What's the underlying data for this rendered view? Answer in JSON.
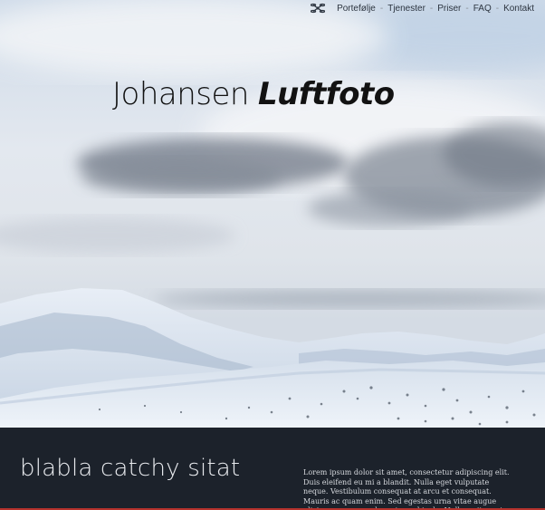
{
  "nav": {
    "logo_icon": "drone-icon",
    "items": [
      "Portefølje",
      "Tjenester",
      "Priser",
      "FAQ",
      "Kontakt"
    ],
    "separator": "-"
  },
  "hero": {
    "title_light": "Johansen",
    "title_bold": "Luftfoto"
  },
  "band": {
    "quote": "blabla catchy sitat",
    "body": "Lorem ipsum dolor sit amet, consectetur adipiscing elit. Duis eleifend eu mi a blandit. Nulla eget vulputate neque. Vestibulum consequat at arcu et consequat. Mauris ac quam enim. Sed egestas urna vitae augue ultrices, ac commodo metus vehicula. Nullam sit amet congue dolor. In quis"
  },
  "colors": {
    "band_bg": "#1c222b",
    "accent": "#b5332d",
    "title_text": "#121212"
  }
}
